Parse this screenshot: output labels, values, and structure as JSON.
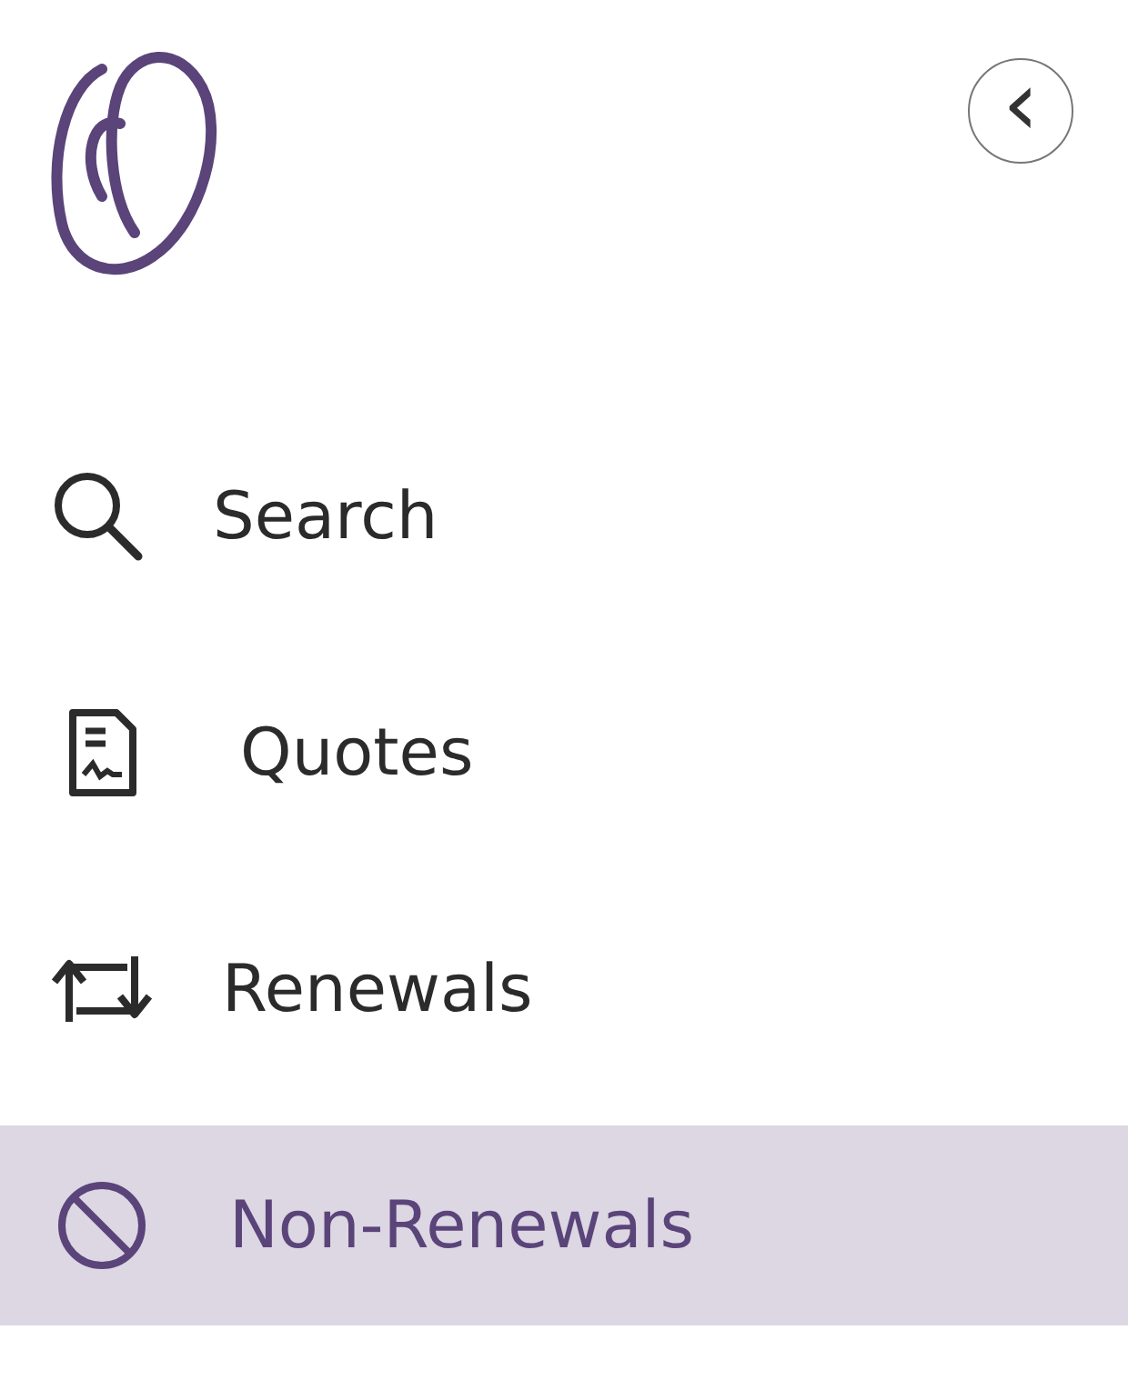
{
  "header": {
    "collapse_button": {
      "label": "‹"
    }
  },
  "nav": [
    {
      "label": "Search",
      "kind": "search",
      "selected": false
    },
    {
      "label": "Quotes",
      "kind": "quotes",
      "selected": false
    },
    {
      "label": "Renewals",
      "kind": "renewals",
      "selected": false
    },
    {
      "label": "Non-Renewals",
      "kind": "nonrenewals",
      "selected": true
    }
  ]
}
